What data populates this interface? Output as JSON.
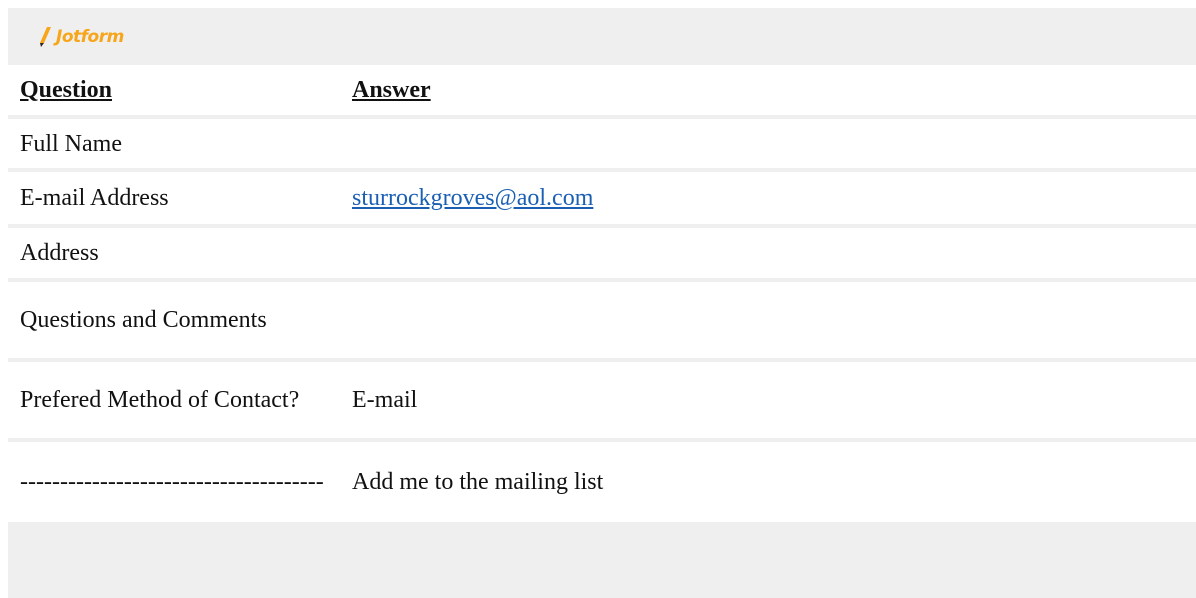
{
  "brand": {
    "name": "Jotform",
    "logo_icon": "pencil-icon",
    "logo_color": "#f7a51a"
  },
  "table": {
    "headers": {
      "question": "Question",
      "answer": "Answer"
    },
    "rows": [
      {
        "question": "Full Name",
        "answer": ""
      },
      {
        "question": "E-mail Address",
        "answer": "sturrockgroves@aol.com"
      },
      {
        "question": "Address",
        "answer": ""
      },
      {
        "question": "Questions and Comments",
        "answer": ""
      },
      {
        "question": "Prefered Method of Contact?",
        "answer": "E-mail"
      },
      {
        "question": "--------------------------------------",
        "answer": "Add me to the mailing list"
      }
    ]
  },
  "colors": {
    "background": "#efefef",
    "row": "#ffffff",
    "link": "#1a5fb4"
  }
}
